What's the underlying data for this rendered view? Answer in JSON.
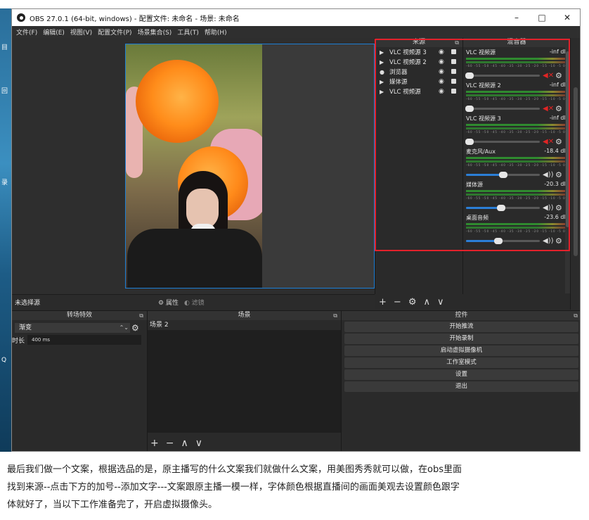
{
  "window": {
    "title": "OBS 27.0.1 (64-bit, windows) - 配置文件: 未命名 - 场景: 未命名",
    "minimize": "–",
    "maximize": "□",
    "close": "✕"
  },
  "desktop_icons": [
    "目",
    "回",
    "录",
    "Q"
  ],
  "menu": [
    "文件(F)",
    "编辑(E)",
    "视图(V)",
    "配置文件(P)",
    "场景集合(S)",
    "工具(T)",
    "帮助(H)"
  ],
  "sources": {
    "title": "来源",
    "items": [
      {
        "label": "VLC 视频源 3",
        "icon": "play-icon"
      },
      {
        "label": "VLC 视频源 2",
        "icon": "play-icon"
      },
      {
        "label": "浏览器",
        "icon": "globe-icon"
      },
      {
        "label": "媒体源",
        "icon": "play-icon"
      },
      {
        "label": "VLC 视频源",
        "icon": "play-icon"
      }
    ],
    "toolbar": [
      "+",
      "−",
      "⚙",
      "∧",
      "∨"
    ]
  },
  "mixer": {
    "title": "混音器",
    "ticks": "-60 -55 -50 -45 -40 -35 -30 -25 -20 -15 -10 -5 0",
    "channels": [
      {
        "name": "VLC 视频源",
        "db": "-inf dB",
        "muted": true,
        "volume": 0.05
      },
      {
        "name": "VLC 视频源 2",
        "db": "-inf dB",
        "muted": true,
        "volume": 0.05
      },
      {
        "name": "VLC 视频源 3",
        "db": "-inf dB",
        "muted": true,
        "volume": 0.05
      },
      {
        "name": "麦克风/Aux",
        "db": "-18.4 dB",
        "muted": false,
        "volume": 0.5
      },
      {
        "name": "媒体源",
        "db": "-20.3 dB",
        "muted": false,
        "volume": 0.48
      },
      {
        "name": "桌面音频",
        "db": "-23.6 dB",
        "muted": false,
        "volume": 0.44
      }
    ]
  },
  "preview_bar": {
    "no_source": "未选择源",
    "properties": "属性",
    "filters": "滤镜"
  },
  "transitions": {
    "title": "转场特效",
    "selected": "渐变",
    "duration_label": "时长",
    "duration_value": "400 ms"
  },
  "scenes": {
    "title": "场景",
    "items": [
      "场景 2"
    ],
    "toolbar": [
      "+",
      "−",
      "∧",
      "∨"
    ]
  },
  "controls": {
    "title": "控件",
    "buttons": [
      "开始推流",
      "开始录制",
      "启动虚拟摄像机",
      "工作室模式",
      "设置",
      "退出"
    ]
  },
  "caption": {
    "line1": "最后我们做一个文案，根据选品的是，原主播写的什么文案我们就做什么文案，用美图秀秀就可以做，在obs里面",
    "line2": "找到来源--点击下方的加号--添加文字---文案跟原主播一模一样，字体颜色根据直播间的画面美观去设置颜色跟字",
    "line3": "体就好了，当以下工作准备完了，开启虚拟摄像头。"
  }
}
